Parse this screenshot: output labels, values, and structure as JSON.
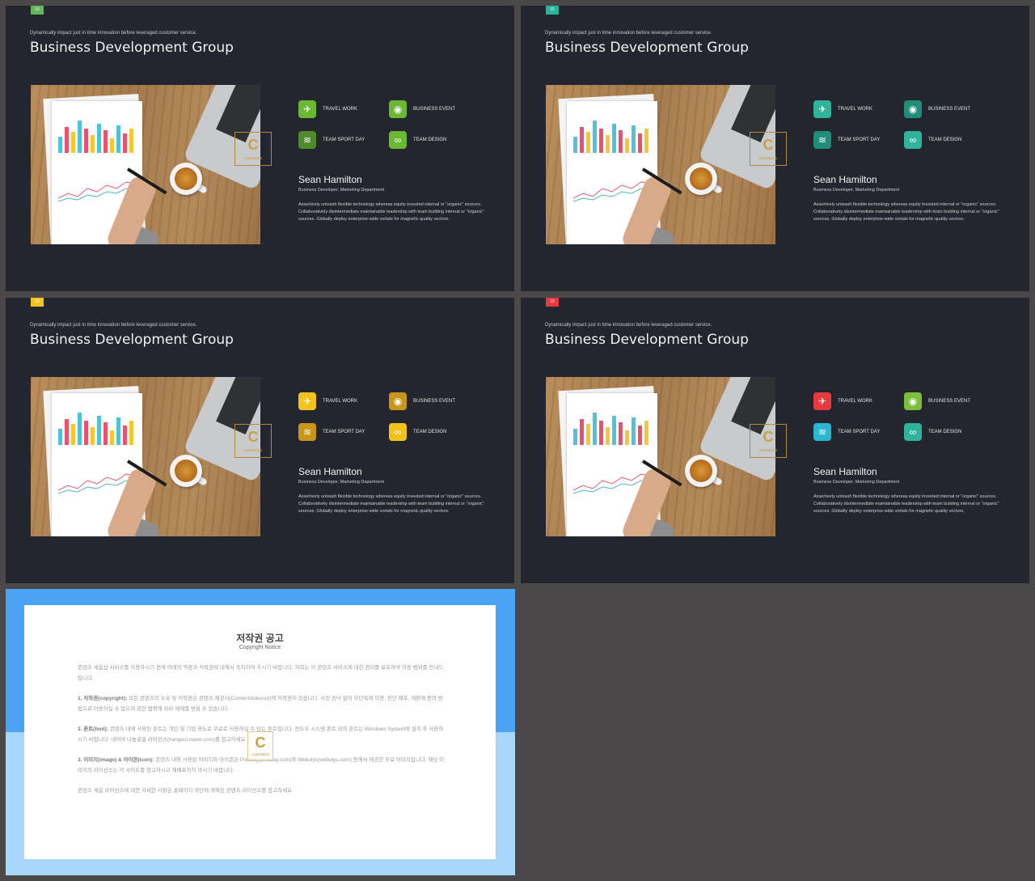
{
  "slides": [
    {
      "badge": "15",
      "badge_color": "#5fb85a",
      "tagline": "Dynamically impact just in time innovation  before leveraged customer service.",
      "title": "Business Development Group",
      "icons": [
        {
          "label": "TRAVEL WORK",
          "icon": "airplane-icon",
          "color": "#6bb832"
        },
        {
          "label": "BUSINESS EVENT",
          "icon": "dinner-plate-icon",
          "color": "#6bb832"
        },
        {
          "label": "TEAM SPORT DAY",
          "icon": "swimmer-icon",
          "color": "#4f8a2a"
        },
        {
          "label": "TEAM DESIGN",
          "icon": "glasses-icon",
          "color": "#6bb832"
        }
      ],
      "person": "Sean Hamilton",
      "role": "Business Developer, Marketing Department",
      "description": "Assertively unleash flexible technology whereas equity invested internal or \"organic\" sources. Collaboratively disintermediate maintainable leadership with team building internal or \"organic\" sources. Globally deploy enterprise-wide vortals for magnetic quality vectors."
    },
    {
      "badge": "15",
      "badge_color": "#2ab39a",
      "tagline": "Dynamically impact just in time innovation  before leveraged customer service.",
      "title": "Business Development Group",
      "icons": [
        {
          "label": "TRAVEL WORK",
          "icon": "airplane-icon",
          "color": "#2fb39a"
        },
        {
          "label": "BUSINESS EVENT",
          "icon": "dinner-plate-icon",
          "color": "#1f8d77"
        },
        {
          "label": "TEAM SPORT DAY",
          "icon": "swimmer-icon",
          "color": "#1f8d77"
        },
        {
          "label": "TEAM DESIGN",
          "icon": "glasses-icon",
          "color": "#2fb39a"
        }
      ],
      "person": "Sean Hamilton",
      "role": "Business Developer, Marketing Department",
      "description": "Assertively unleash flexible technology whereas equity invested internal or \"organic\" sources. Collaboratively disintermediate maintainable leadership with team building internal or \"organic\" sources. Globally deploy enterprise-wide vortals for magnetic quality vectors."
    },
    {
      "badge": "15",
      "badge_color": "#f3c31f",
      "tagline": "Dynamically impact just in time innovation  before leveraged customer service.",
      "title": "Business Development Group",
      "icons": [
        {
          "label": "TRAVEL WORK",
          "icon": "airplane-icon",
          "color": "#f2c31c"
        },
        {
          "label": "BUSINESS EVENT",
          "icon": "dinner-plate-icon",
          "color": "#c8961b"
        },
        {
          "label": "TEAM SPORT DAY",
          "icon": "swimmer-icon",
          "color": "#c8961b"
        },
        {
          "label": "TEAM DESIGN",
          "icon": "glasses-icon",
          "color": "#f2c31c"
        }
      ],
      "person": "Sean Hamilton",
      "role": "Business Developer, Marketing Department",
      "description": "Assertively unleash flexible technology whereas equity invested internal or \"organic\" sources. Collaboratively disintermediate maintainable leadership with team building internal or \"organic\" sources. Globally deploy enterprise-wide vortals for magnetic quality vectors."
    },
    {
      "badge": "15",
      "badge_color": "#e5393f",
      "tagline": "Dynamically impact just in time innovation  before leveraged customer service.",
      "title": "Business Development Group",
      "icons": [
        {
          "label": "TRAVEL WORK",
          "icon": "airplane-icon",
          "color": "#e8393e"
        },
        {
          "label": "BUSINESS EVENT",
          "icon": "dinner-plate-icon",
          "color": "#7cbf3a"
        },
        {
          "label": "TEAM SPORT DAY",
          "icon": "swimmer-icon",
          "color": "#2bb6d4"
        },
        {
          "label": "TEAM DESIGN",
          "icon": "glasses-icon",
          "color": "#2fb39a"
        }
      ],
      "person": "Sean Hamilton",
      "role": "Business Developer, Marketing Department",
      "description": "Assertively unleash flexible technology whereas equity invested internal or \"organic\" sources. Collaboratively disintermediate maintainable leadership with team building internal or \"organic\" sources. Globally deploy enterprise-wide vortals for magnetic quality vectors."
    }
  ],
  "copyright": {
    "title": "저작권 공고",
    "subtitle": "Copyright Notice",
    "intro": "콘텐츠 세움삽 서비스를 이용하시기 전에 아래의 약관과 저작권에 대해서 숙지하여 주시기 바랍니다. 저희는 이 콘텐츠 서비스에 대한 권리를 보호하며 이용 범위를 안내드립니다.",
    "sections": [
      {
        "heading": "1. 저작권(copyright):",
        "text": "모든 콘텐츠의 소유 및 저작권은 콘텐츠 제공사(Contentstokeout)에 저작권이 있습니다. 사전 승낙 없이 무단복제 이용, 전단 배포, 재판매 등의 방법으로 이용하실 수 없으며 관련 법령에 따라 제재를 받을 수 있습니다."
      },
      {
        "heading": "2. 폰트(font):",
        "text": "콘텐츠 내에 사용된 폰트는 개인 및 기업 용도로 무료로 사용하실 수 있는 폰트입니다. 윈도우 시스템 폰트 외의 폰트는 Windows System에 설치 후 사용하시기 바랍니다. 네이버 나눔글꼴 라이선스(hangeul.naver.com)를 참고하세요."
      },
      {
        "heading": "3. 이미지(image) & 아이콘(icon):",
        "text": "콘텐츠 내에 사용된 이미지와 아이콘은 Pixabay(pixabay.com)와 Webolys(webolys.com) 등에서 제공한 무료 이미지입니다. 해당 이미지의 라이선스는 각 사이트를 참고하시고 재배포하지 마시기 바랍니다."
      }
    ],
    "footer": "콘텐츠 세움 라이선스에 대한 자세한 사항은 홈페이지 하단에 게재된 콘텐츠 라이선스를 참고하세요."
  }
}
